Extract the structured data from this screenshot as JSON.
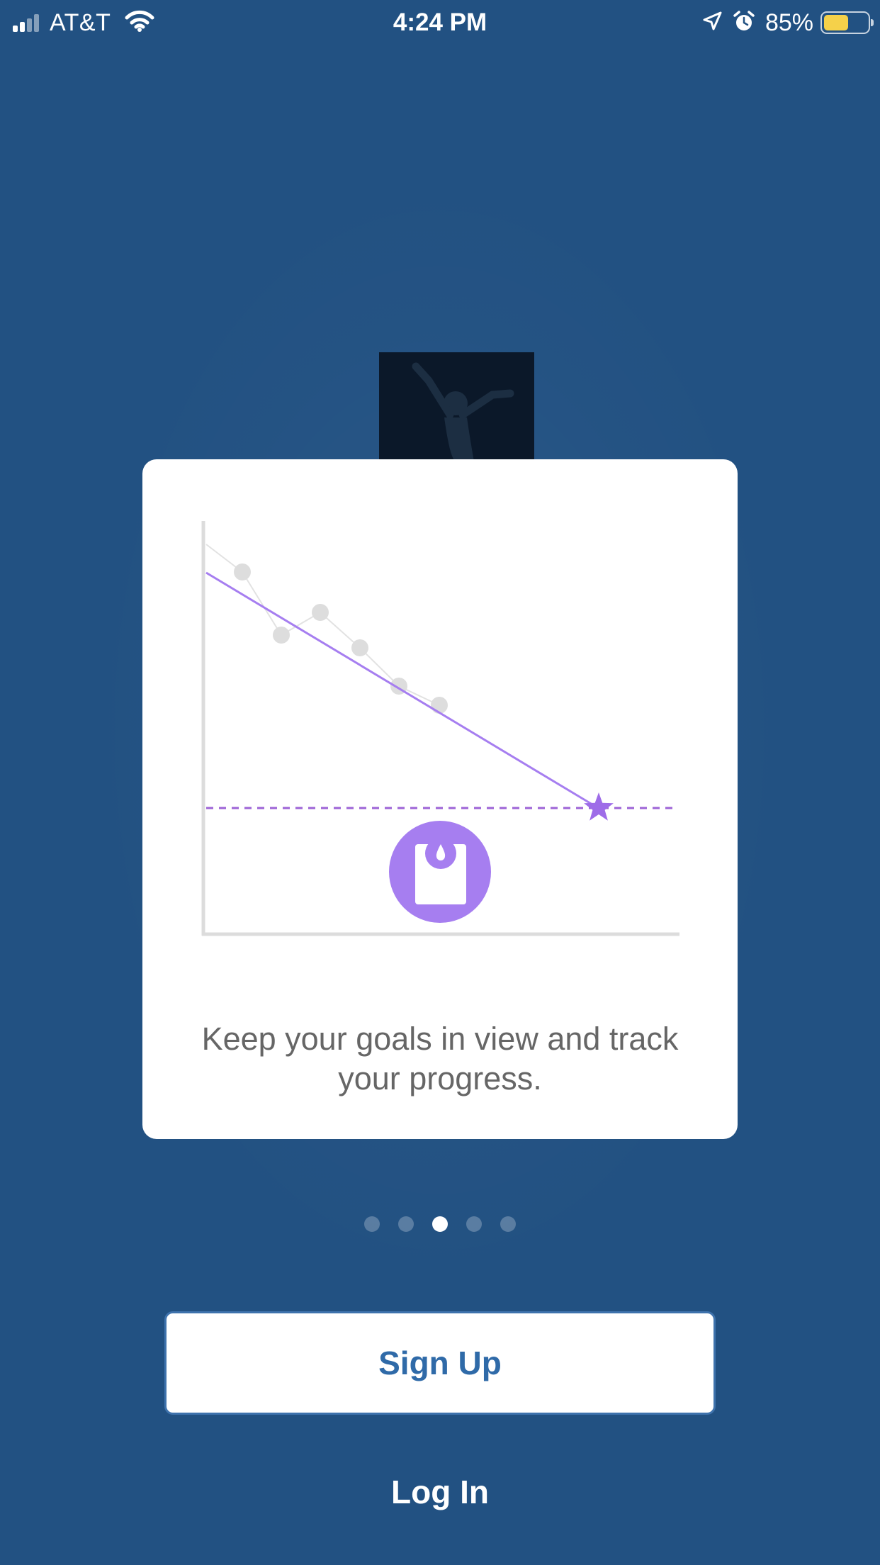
{
  "status_bar": {
    "carrier": "AT&T",
    "time": "4:24 PM",
    "battery_percent": "85%",
    "battery_level": 0.85,
    "icons": [
      "signal-icon",
      "wifi-icon",
      "location-arrow-icon",
      "alarm-icon",
      "battery-icon"
    ]
  },
  "hero": {
    "icon": "person-celebrating-icon"
  },
  "card": {
    "caption": "Keep your goals in view and track your progress.",
    "illustration": {
      "goal_icon": "star-icon",
      "scale_icon": "scale-icon"
    }
  },
  "pagination": {
    "total": 5,
    "active_index": 2
  },
  "actions": {
    "signup_label": "Sign Up",
    "login_label": "Log In"
  },
  "colors": {
    "background": "#225182",
    "card": "#ffffff",
    "accent_purple": "#a67ef0",
    "caption_text": "#666666",
    "button_text": "#2f6aa8",
    "battery": "#f5d14a"
  }
}
